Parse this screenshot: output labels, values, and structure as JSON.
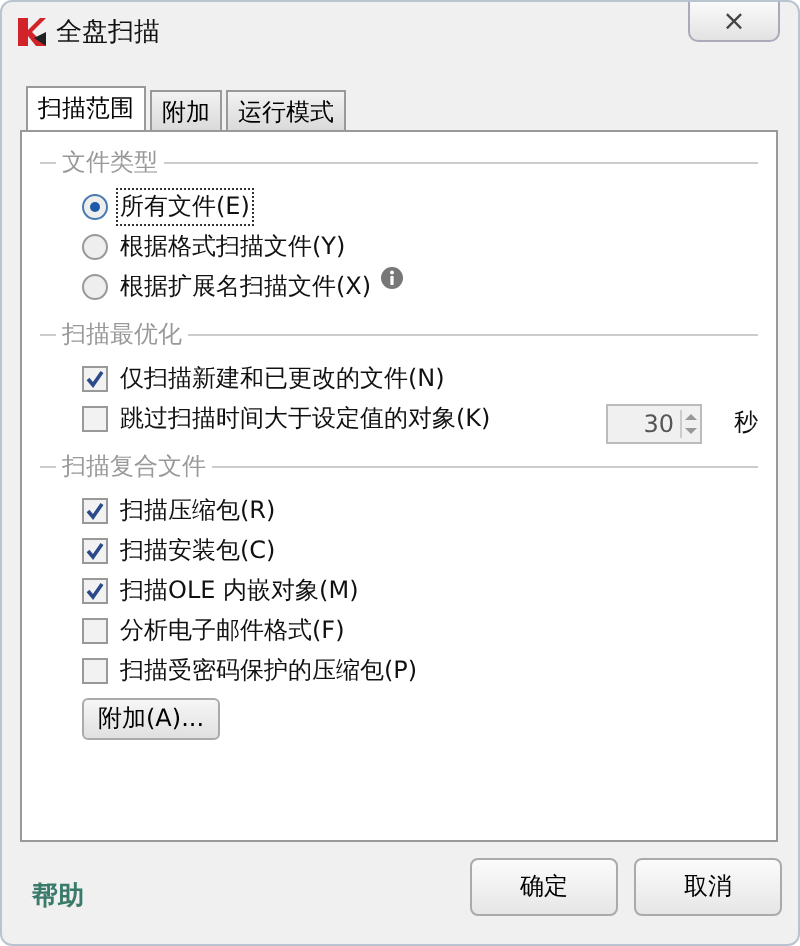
{
  "window": {
    "title": "全盘扫描",
    "close": "×"
  },
  "tabs": [
    {
      "label": "扫描范围",
      "selected": true
    },
    {
      "label": "附加",
      "selected": false
    },
    {
      "label": "运行模式",
      "selected": false
    }
  ],
  "sections": [
    {
      "title": "文件类型",
      "items": [
        {
          "kind": "radio",
          "label": "所有文件(E)",
          "selected": true,
          "focused": true
        },
        {
          "kind": "radio",
          "label": "根据格式扫描文件(Y)",
          "selected": false
        },
        {
          "kind": "radio",
          "label": "根据扩展名扫描文件(X)",
          "selected": false,
          "info": true
        }
      ]
    },
    {
      "title": "扫描最优化",
      "items": [
        {
          "kind": "checkbox",
          "label": "仅扫描新建和已更改的文件(N)",
          "checked": true
        },
        {
          "kind": "checkbox",
          "label": "跳过扫描时间大于设定值的对象(K)",
          "checked": false,
          "spin": {
            "value": "30",
            "unit": "秒",
            "disabled": true
          }
        }
      ]
    },
    {
      "title": "扫描复合文件",
      "items": [
        {
          "kind": "checkbox",
          "label": "扫描压缩包(R)",
          "checked": true
        },
        {
          "kind": "checkbox",
          "label": "扫描安装包(C)",
          "checked": true
        },
        {
          "kind": "checkbox",
          "label": "扫描OLE 内嵌对象(M)",
          "checked": true
        },
        {
          "kind": "checkbox",
          "label": "分析电子邮件格式(F)",
          "checked": false
        },
        {
          "kind": "checkbox",
          "label": "扫描受密码保护的压缩包(P)",
          "checked": false
        }
      ]
    }
  ],
  "extra_button": "附加(A)...",
  "footer": {
    "help": "帮助",
    "buttons": [
      "确定",
      "取消"
    ]
  }
}
